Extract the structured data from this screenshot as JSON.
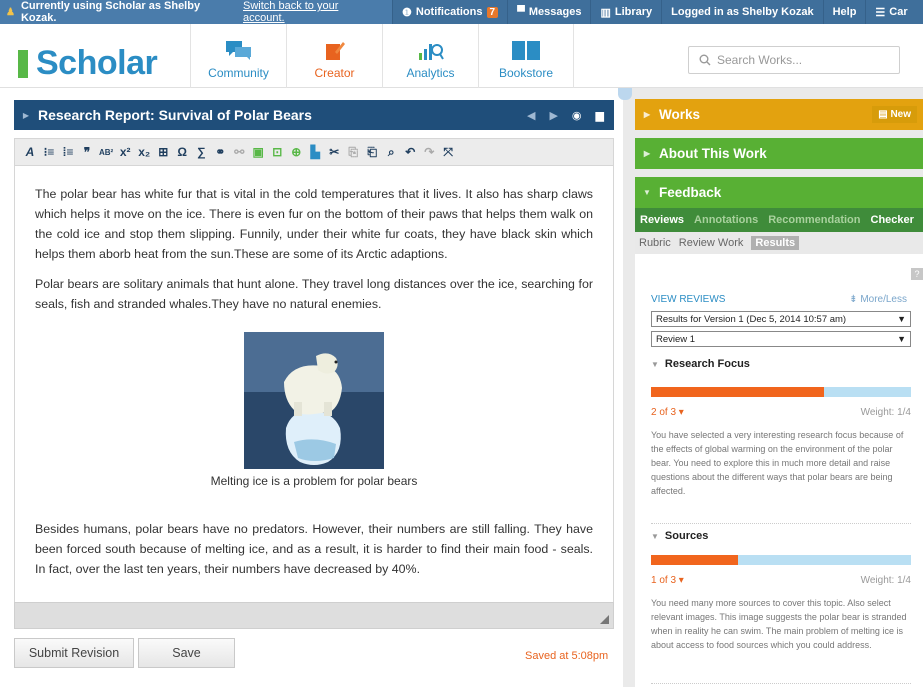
{
  "topbar": {
    "masquerade_text": "Currently using Scholar as Shelby Kozak.",
    "switch_link": "Switch back to your account.",
    "notifications_label": "Notifications",
    "notifications_count": "7",
    "messages_label": "Messages",
    "library_label": "Library",
    "logged_in_label": "Logged in as Shelby Kozak",
    "help_label": "Help",
    "cart_label": "Car"
  },
  "header": {
    "logo_text": "Scholar",
    "nav": [
      {
        "label": "Community",
        "icon": "chat-bubbles-icon",
        "color": "#2b8dc4"
      },
      {
        "label": "Creator",
        "icon": "pencil-icon",
        "color": "#e8631f"
      },
      {
        "label": "Analytics",
        "icon": "bar-chart-icon",
        "color": "#2b8dc4"
      },
      {
        "label": "Bookstore",
        "icon": "book-icon",
        "color": "#2b8dc4"
      }
    ],
    "search_placeholder": "Search Works..."
  },
  "editor": {
    "title": "Research Report: Survival of Polar Bears",
    "paragraphs": [
      "The polar bear has white fur that is vital in the cold temperatures that it lives. It also has sharp claws which helps it move on the ice. There is even fur on the bottom of their paws that helps them walk on the cold ice and stop them slipping. Funnily, under their white fur coats, they have black skin which helps them aborb heat from the sun.These are some of its Arctic adaptions.",
      "Polar bears are solitary animals that hunt alone. They travel long distances over the ice, searching for seals, fish and stranded whales.They have no natural enemies.",
      "Besides humans, polar bears have no predators. However, their numbers are still falling. They have been forced south because of melting ice, and as a result, it is harder to find their main food - seals. In fact, over the last ten years, their numbers have decreased by 40%."
    ],
    "image_caption": "Melting ice is a problem for polar bears",
    "submit_label": "Submit Revision",
    "save_label": "Save",
    "saved_status": "Saved at 5:08pm"
  },
  "panel": {
    "works_label": "Works",
    "new_label": "New",
    "about_label": "About This Work",
    "feedback_label": "Feedback",
    "feedback_tabs": [
      "Reviews",
      "Annotations",
      "Recommendation",
      "Checker"
    ],
    "sub_tabs": [
      "Rubric",
      "Review Work",
      "Results"
    ],
    "help_mark": "?",
    "view_reviews": "VIEW REVIEWS",
    "more_less": "More/Less",
    "version_select": "Results for Version 1 (Dec 5, 2014 10:57 am)",
    "review_select": "Review 1",
    "sections": [
      {
        "title": "Research Focus",
        "score": "2 of 3",
        "progress": 0.667,
        "weight": "Weight: 1/4",
        "comment": "You have selected a very interesting research focus because of the effects of global warming on the environment of the polar bear. You need to explore this in much more detail and raise questions about the different ways that polar bears are being affected."
      },
      {
        "title": "Sources",
        "score": "1 of 3",
        "progress": 0.333,
        "weight": "Weight: 1/4",
        "comment": "You need many more sources to cover this topic. Also select relevant images. This image suggests the polar bear is stranded when in reality he can swim. The main problem of melting ice is about access to food sources which you could address."
      }
    ]
  },
  "colors": {
    "works_header": "#e3a20f",
    "about_header": "#58b034",
    "feedback_header": "#58b034",
    "editor_title": "#1f4e7a",
    "accent_orange": "#e8631f"
  }
}
